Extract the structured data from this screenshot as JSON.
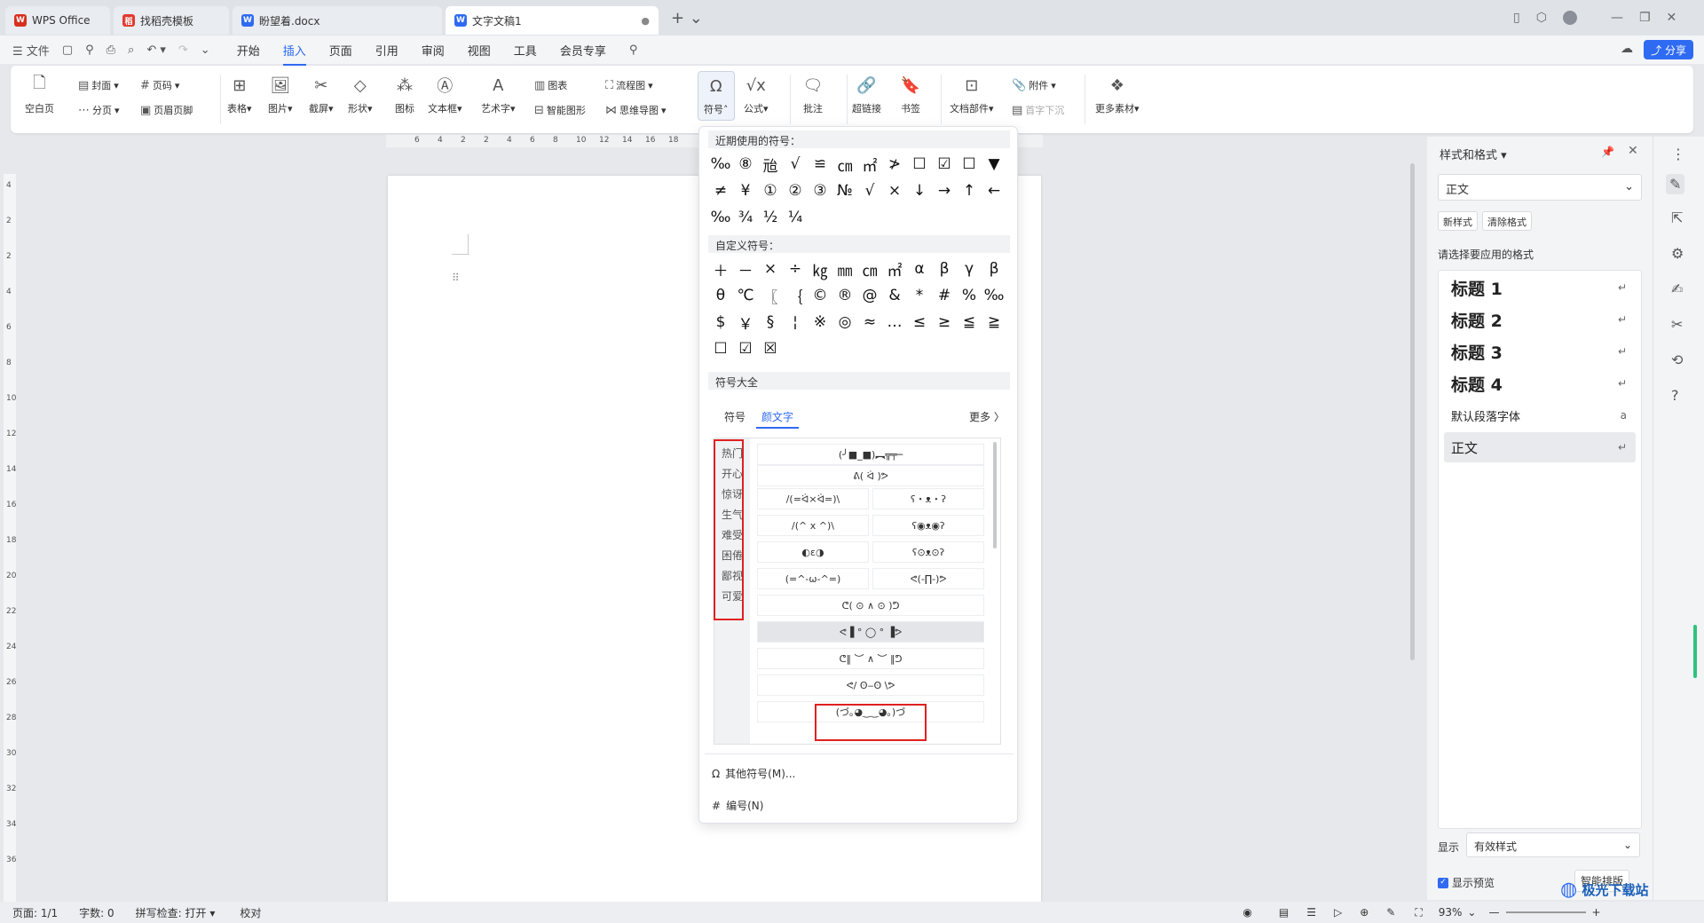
{
  "tabs": [
    {
      "icon": "W",
      "label": "WPS Office",
      "color": "#d8301f"
    },
    {
      "icon": "稻",
      "label": "找稻壳模板",
      "color": "#e23a2e"
    },
    {
      "icon": "W",
      "label": "盼望着.docx",
      "color": "#2f6bf2"
    },
    {
      "icon": "W",
      "label": "文字文稿1",
      "color": "#2f6bf2"
    }
  ],
  "menu": {
    "file": "文件",
    "items": [
      "开始",
      "插入",
      "页面",
      "引用",
      "审阅",
      "视图",
      "工具",
      "会员专享"
    ],
    "active": "插入",
    "share": "分享"
  },
  "ribbon": {
    "blank": "空白页",
    "cover": "封面",
    "pagebreak": "分页",
    "pagenum": "页码",
    "headerfooter": "页眉页脚",
    "table": "表格",
    "picture": "图片",
    "screenshot": "截屏",
    "shape": "形状",
    "icon": "图标",
    "textbox": "文本框",
    "wordart": "艺术字",
    "chart": "图表",
    "smartart": "智能图形",
    "flowchart": "流程图",
    "mindmap": "思维导图",
    "symbol": "符号",
    "formula": "公式",
    "comment": "批注",
    "hyperlink": "超链接",
    "bookmark": "书签",
    "docparts": "文档部件",
    "attachment": "附件",
    "dropcap": "首字下沉",
    "more": "更多素材"
  },
  "ruler": {
    "h": [
      "6",
      "4",
      "2",
      "2",
      "4",
      "6",
      "8",
      "10",
      "12",
      "14",
      "16",
      "18"
    ],
    "v": [
      "4",
      "2",
      "2",
      "4",
      "6",
      "8",
      "10",
      "12",
      "14",
      "16",
      "18",
      "20",
      "22",
      "24",
      "26",
      "28",
      "30",
      "32",
      "34",
      "36"
    ]
  },
  "dropdown": {
    "recent_title": "近期使用的符号：",
    "recent": [
      "‰",
      "⑧",
      "兘",
      "√",
      "≌",
      "㎝",
      "㎡",
      "≯",
      "☐",
      "☑",
      "☐",
      "▼",
      "≠",
      "¥",
      "①",
      "②",
      "③",
      "№",
      "√",
      "×",
      "↓",
      "→",
      "↑",
      "←",
      "‰",
      "¾",
      "½",
      "¼"
    ],
    "custom_title": "自定义符号：",
    "custom": [
      "＋",
      "－",
      "×",
      "÷",
      "㎏",
      "㎜",
      "㎝",
      "㎡",
      "α",
      "β",
      "γ",
      "β",
      "θ",
      "℃",
      "〖",
      "｛",
      "©",
      "®",
      "@",
      "&",
      "*",
      "#",
      "%",
      "‰",
      "$",
      "￥",
      "§",
      "¦",
      "※",
      "◎",
      "≈",
      "…",
      "≤",
      "≥",
      "≦",
      "≧",
      "☐",
      "☑",
      "☒"
    ],
    "all_title": "符号大全",
    "ktabs": [
      "符号",
      "颜文字"
    ],
    "ktab_active": "颜文字",
    "more": "更多 〉",
    "cats": [
      "热门",
      "开心",
      "惊讶",
      "生气",
      "难受",
      "困倦",
      "鄙视",
      "可爱"
    ],
    "kaomoji_full": [
      "(╯■_■)︻╦╤─",
      "ᕕ( ᐛ )ᕗ"
    ],
    "kaomoji_pairs": [
      [
        "/(=ᐛ×ᐛ=)\\",
        "ʕ・ᴥ・ʔ"
      ],
      [
        "/(^ x ^)\\",
        "ʕ◉ᴥ◉ʔ"
      ],
      [
        "◐ε◑",
        "ʕ⊙ᴥ⊙ʔ"
      ],
      [
        "(=^-ω-^=)",
        "ᕙ(-∏-)ᕗ"
      ]
    ],
    "kaomoji_full2": [
      "ᕦ( ⊙ ∧ ⊙ )ᕤ",
      "ᕙ▐ ° ◯ ° ▐ᕗ",
      "ᕦ‖ ︶ ∧ ︶ ‖ᕤ",
      "ᕙ/ ʘ‒ʘ \\ᕗ",
      "(づ｡◕‿‿◕｡)づ"
    ],
    "other": "其他符号(M)...",
    "numbering": "编号(N)"
  },
  "panel": {
    "title": "样式和格式 ▾",
    "current": "正文",
    "new": "新样式",
    "clear": "清除格式",
    "choose": "请选择要应用的格式",
    "styles": [
      {
        "label": "标题 1",
        "tail": "↵"
      },
      {
        "label": "标题 2",
        "tail": "↵"
      },
      {
        "label": "标题 3",
        "tail": "↵"
      },
      {
        "label": "标题 4",
        "tail": "↵"
      },
      {
        "label": "默认段落字体",
        "tail": "a"
      },
      {
        "label": "正文",
        "tail": "↵"
      }
    ],
    "show_label": "显示",
    "show_value": "有效样式",
    "preview": "显示预览",
    "smart": "智能排版"
  },
  "status": {
    "page": "页面: 1/1",
    "words": "字数: 0",
    "spell": "拼写检查: 打开 ▾",
    "proof": "校对",
    "zoom": "93%"
  },
  "watermark": "极光下载站"
}
